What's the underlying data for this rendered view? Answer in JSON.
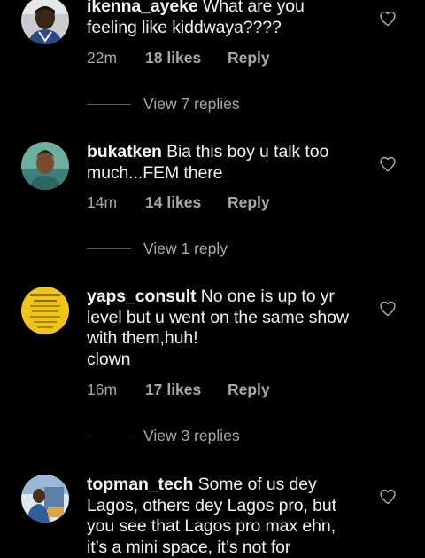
{
  "comments": [
    {
      "username": "ikenna_ayeke",
      "text": "What are you feeling like kiddwaya????",
      "time": "22m",
      "likes": "18 likes",
      "reply": "Reply",
      "view_replies": "View 7 replies"
    },
    {
      "username": "bukatken",
      "text": "Bia this boy u talk too much...FEM there",
      "time": "14m",
      "likes": "14 likes",
      "reply": "Reply",
      "view_replies": "View 1 reply"
    },
    {
      "username": "yaps_consult",
      "text": "No one is up to yr level but u went on the same show with them,huh!",
      "text2": "clown",
      "time": "16m",
      "likes": "17 likes",
      "reply": "Reply",
      "view_replies": "View 3 replies"
    },
    {
      "username": "topman_tech",
      "text": "Some of us dey Lagos, others dey Lagos pro, but you see that Lagos pro max ehn, it’s a mini space, it’s not for"
    }
  ],
  "icons": {
    "like": "heart-outline-icon"
  },
  "colors": {
    "background": "#000000",
    "primary_text": "#f5f5f5",
    "secondary_text": "#a8a8a8"
  }
}
